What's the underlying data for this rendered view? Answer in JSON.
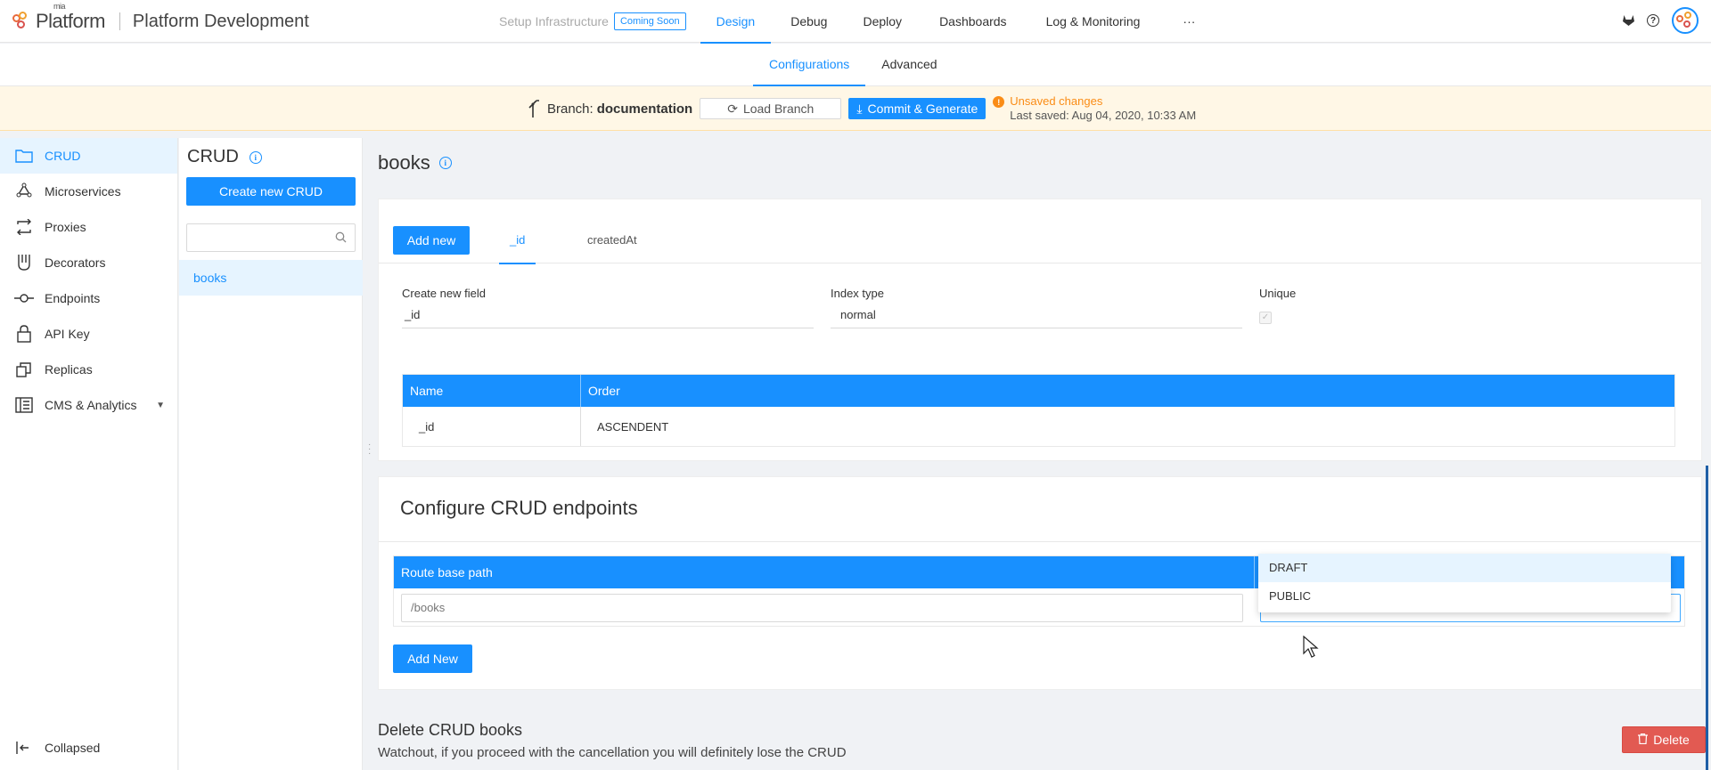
{
  "topbar": {
    "logo_small": "mia",
    "logo_text": "Platform",
    "project_name": "Platform Development",
    "nav": [
      {
        "label": "Setup Infrastructure",
        "badge": "Coming Soon"
      },
      {
        "label": "Design"
      },
      {
        "label": "Debug"
      },
      {
        "label": "Deploy"
      },
      {
        "label": "Dashboards"
      },
      {
        "label": "Log & Monitoring"
      },
      {
        "label": "···"
      }
    ]
  },
  "subnav": {
    "tabs": [
      "Configurations",
      "Advanced"
    ]
  },
  "branchbar": {
    "branch_label": "Branch:",
    "branch_name": "documentation",
    "load_branch": "Load Branch",
    "commit": "Commit & Generate",
    "unsaved": "Unsaved changes",
    "last_saved": "Last saved:  Aug 04, 2020, 10:33 AM"
  },
  "sidebar": {
    "items": [
      {
        "label": "CRUD",
        "icon": "folder-icon"
      },
      {
        "label": "Microservices",
        "icon": "microservices-icon"
      },
      {
        "label": "Proxies",
        "icon": "proxies-icon"
      },
      {
        "label": "Decorators",
        "icon": "decorators-icon"
      },
      {
        "label": "Endpoints",
        "icon": "endpoints-icon"
      },
      {
        "label": "API Key",
        "icon": "lock-icon"
      },
      {
        "label": "Replicas",
        "icon": "replicas-icon"
      },
      {
        "label": "CMS & Analytics",
        "icon": "cms-icon"
      }
    ],
    "collapsed": "Collapsed"
  },
  "crud_panel": {
    "title": "CRUD",
    "create_button": "Create new CRUD",
    "search_placeholder": "",
    "items": [
      "books"
    ]
  },
  "main": {
    "title": "books",
    "indexes": {
      "add_new": "Add new",
      "tabs": [
        "_id",
        "createdAt"
      ],
      "create_field_label": "Create new field",
      "create_field_value": "_id",
      "index_type_label": "Index type",
      "index_type_value": "normal",
      "unique_label": "Unique",
      "table": {
        "headers": [
          "Name",
          "Order"
        ],
        "rows": [
          [
            "_id",
            "ASCENDENT"
          ]
        ]
      }
    },
    "endpoints": {
      "title": "Configure CRUD endpoints",
      "header_route": "Route base path",
      "route_value": "/books",
      "dropdown_options": [
        "DRAFT",
        "PUBLIC"
      ],
      "add_new": "Add New"
    },
    "delete": {
      "title": "Delete CRUD books",
      "subtitle": "Watchout, if you proceed with the cancellation you will definitely lose the CRUD",
      "button": "Delete"
    }
  },
  "colors": {
    "primary": "#1890ff",
    "warning": "#fa8c16",
    "danger": "#e25a52",
    "brand": "#e96a3c"
  }
}
